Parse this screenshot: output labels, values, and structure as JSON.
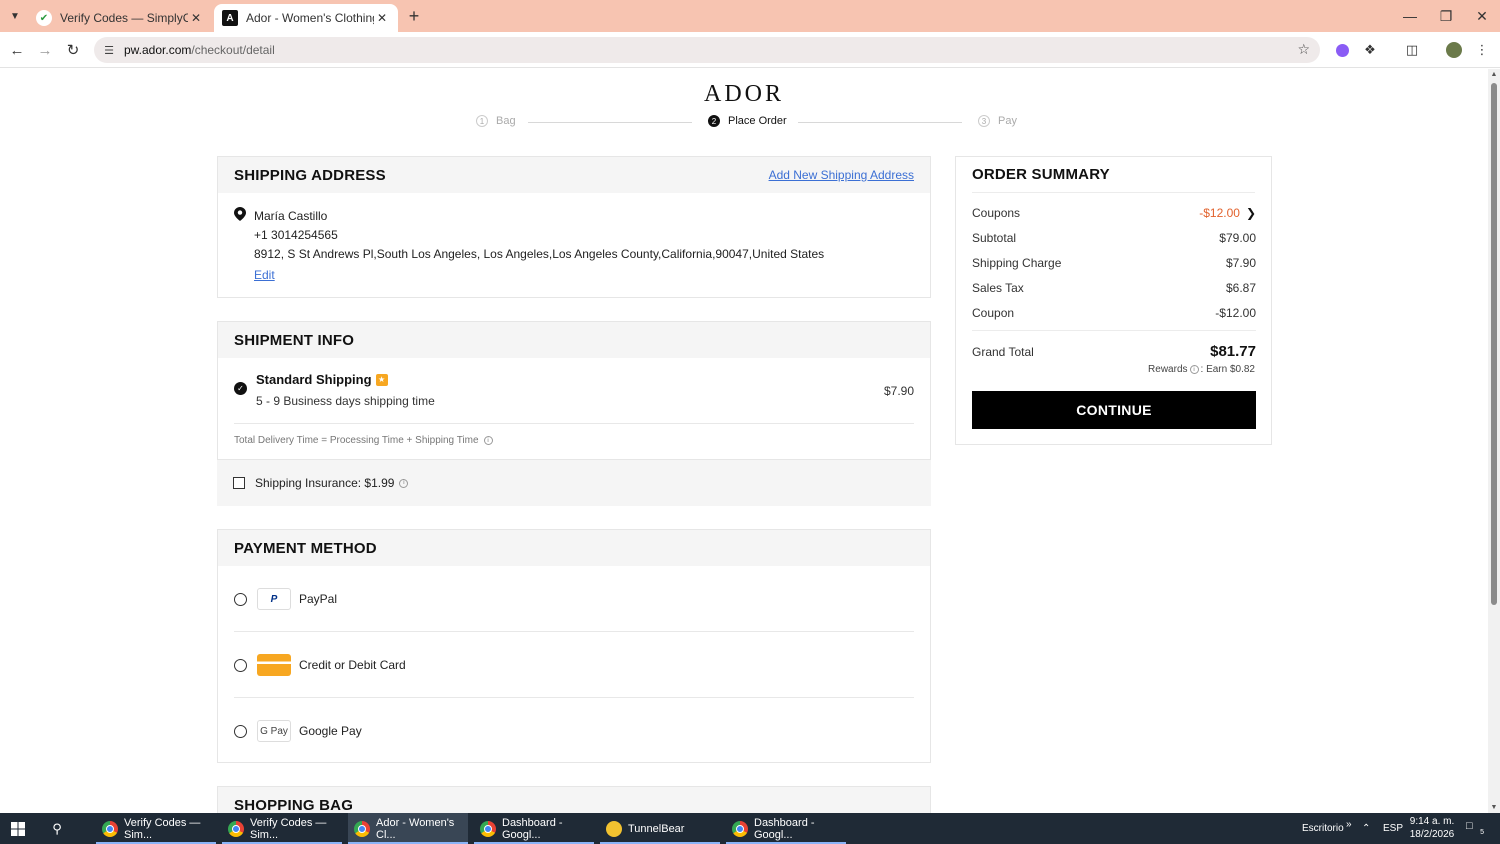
{
  "browser": {
    "tabs": [
      {
        "title": "Verify Codes — SimplyCodes",
        "active": false
      },
      {
        "title": "Ador - Women's Clothing: Dres",
        "active": true
      }
    ],
    "address": {
      "host": "pw.ador.com",
      "path": "/checkout/detail"
    }
  },
  "page": {
    "logo": "ADOR",
    "steps": [
      {
        "num": "1",
        "label": "Bag",
        "state": "done"
      },
      {
        "num": "2",
        "label": "Place Order",
        "state": "active"
      },
      {
        "num": "3",
        "label": "Pay",
        "state": "pending"
      }
    ],
    "shipping_address": {
      "title": "SHIPPING ADDRESS",
      "add_link": "Add New Shipping Address",
      "name": "María Castillo",
      "phone": "+1 3014254565",
      "address": "8912, S St Andrews Pl,South Los Angeles, Los Angeles,Los Angeles County,California,90047,United States",
      "edit": "Edit"
    },
    "shipment_info": {
      "title": "SHIPMENT INFO",
      "method": "Standard Shipping",
      "time": "5 - 9 Business days shipping time",
      "price": "$7.90",
      "note": "Total Delivery Time = Processing Time + Shipping Time",
      "insurance": "Shipping Insurance: $1.99",
      "insurance_checked": false
    },
    "payment_method": {
      "title": "PAYMENT METHOD",
      "options": [
        {
          "label": "PayPal",
          "selected": false
        },
        {
          "label": "Credit or Debit Card",
          "selected": false
        },
        {
          "label": "Google Pay",
          "selected": false
        }
      ],
      "gpay_logo": "G Pay"
    },
    "shopping_bag": {
      "title": "SHOPPING BAG"
    },
    "order_summary": {
      "title": "ORDER SUMMARY",
      "rows": [
        {
          "label": "Coupons",
          "value": "-$12.00"
        },
        {
          "label": "Subtotal",
          "value": "$79.00"
        },
        {
          "label": "Shipping Charge",
          "value": "$7.90"
        },
        {
          "label": "Sales Tax",
          "value": "$6.87"
        },
        {
          "label": "Coupon",
          "value": "-$12.00"
        }
      ],
      "grand_total_label": "Grand Total",
      "grand_total": "$81.77",
      "rewards_label": "Rewards",
      "rewards_value": ": Earn $0.82",
      "continue": "CONTINUE"
    }
  },
  "taskbar": {
    "apps": [
      {
        "label": "Verify Codes — Sim...",
        "active": false
      },
      {
        "label": "Verify Codes — Sim...",
        "active": false
      },
      {
        "label": "Ador - Women's Cl...",
        "active": true
      },
      {
        "label": "Dashboard - Googl...",
        "active": false
      },
      {
        "label": "TunnelBear",
        "active": false
      },
      {
        "label": "Dashboard - Googl...",
        "active": false
      }
    ],
    "desktop_label": "Escritorio",
    "language": "ESP",
    "time": "9:14 a. m.",
    "date": "18/2/2026",
    "notifications": "5"
  },
  "colors": {
    "tabbar": "#f7c4b1",
    "link": "#3b6fd4",
    "discount": "#e2622d",
    "primary_button": "#000000",
    "taskbar": "#1f2a36"
  }
}
